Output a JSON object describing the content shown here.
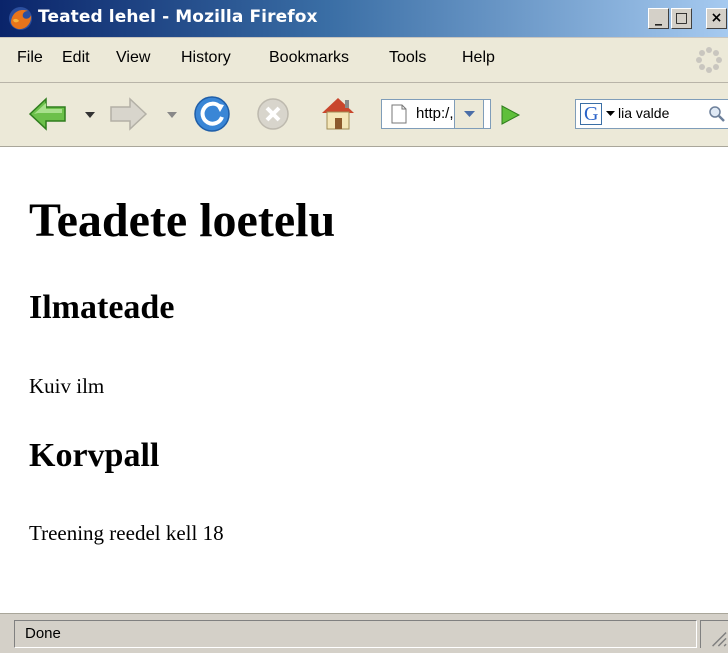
{
  "window": {
    "title": "Teated lehel - Mozilla Firefox",
    "buttons": {
      "minimize": "_",
      "maximize": "□",
      "close": "×"
    }
  },
  "menu": {
    "items": [
      "File",
      "Edit",
      "View",
      "History",
      "Bookmarks",
      "Tools",
      "Help"
    ],
    "mnemonics": [
      "F",
      "E",
      "V",
      "s",
      "B",
      "T",
      "H"
    ]
  },
  "toolbar": {
    "url_value": "http:/,",
    "search_engine": "G",
    "search_value": "lia valde"
  },
  "page": {
    "h1": "Teadete loetelu",
    "sections": [
      {
        "heading": "Ilmateade",
        "text": "Kuiv ilm"
      },
      {
        "heading": "Korvpall",
        "text": "Treening reedel kell 18"
      }
    ]
  },
  "status": {
    "text": "Done"
  },
  "colors": {
    "titlebar_start": "#0a246a",
    "titlebar_end": "#a6caf0",
    "chrome": "#ece9d8",
    "content_bg": "#ffffff"
  },
  "icons": {
    "back": "back-arrow-icon",
    "forward": "forward-arrow-icon",
    "reload": "reload-icon",
    "stop": "stop-icon",
    "home": "home-icon",
    "page": "page-icon",
    "go": "go-arrow-icon",
    "search": "magnifier-icon"
  }
}
